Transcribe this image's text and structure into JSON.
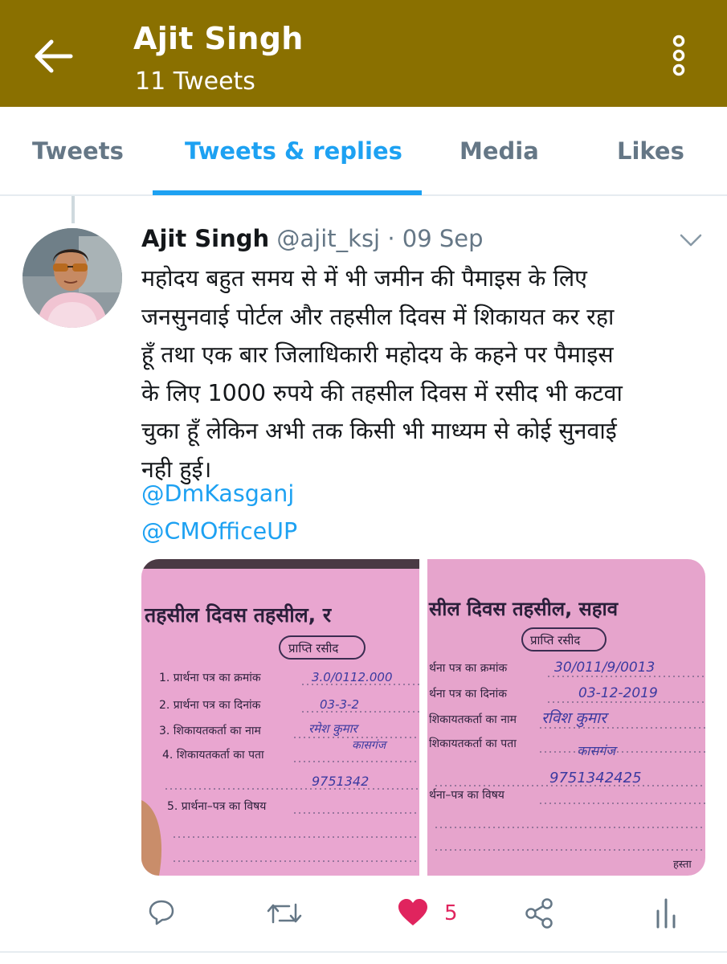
{
  "header": {
    "name": "Ajit Singh",
    "tweet_count": "11 Tweets",
    "background": "#8a7000"
  },
  "tabs": [
    {
      "label": "Tweets",
      "active": false
    },
    {
      "label": "Tweets & replies",
      "active": true
    },
    {
      "label": "Media",
      "active": false
    },
    {
      "label": "Likes",
      "active": false
    }
  ],
  "tweet": {
    "name": "Ajit Singh",
    "handle": "@ajit_ksj",
    "separator": "·",
    "date": "09 Sep",
    "text_lines": [
      "महोदय बहुत समय से में भी जमीन की पैमाइस के लिए",
      "जनसुनवाई पोर्टल और तहसील दिवस में शिकायत कर रहा",
      "हूँ तथा एक बार जिलाधिकारी महोदय के कहने पर पैमाइस",
      "के लिए 1000 रुपये की तहसील दिवस में रसीद भी कटवा",
      "चुका हूँ लेकिन अभी तक किसी भी माध्यम से कोई सुनवाई",
      "नही हुई।"
    ],
    "mentions": [
      "@DmKasganj",
      "@CMOfficeUP"
    ],
    "images": [
      {
        "heading": "तहसील दिवस तहसील, र",
        "stamp": "प्राप्ति रसीद",
        "rows": [
          {
            "label": "1. प्रार्थना पत्र का क्रमांक",
            "handwritten": "3.0/0112.000"
          },
          {
            "label": "2. प्रार्थना पत्र का दिनांक",
            "handwritten": "03-3-2"
          },
          {
            "label": "3. शिकायतकर्ता का नाम",
            "handwritten": "रमेश कुमार"
          },
          {
            "label": "4. शिकायतकर्ता का पता",
            "handwritten": "कासगंज"
          },
          {
            "label": "",
            "handwritten": "9751342"
          },
          {
            "label": "5. प्रार्थना–पत्र का विषय",
            "handwritten": ""
          }
        ]
      },
      {
        "heading": "सील दिवस तहसील, सहाव",
        "stamp": "प्राप्ति रसीद",
        "rows": [
          {
            "label": "र्थना पत्र का क्रमांक",
            "handwritten": "30/011/9/0013"
          },
          {
            "label": "र्थना पत्र का दिनांक",
            "handwritten": "03-12-2019"
          },
          {
            "label": "शिकायतकर्ता का नाम",
            "handwritten": "रविश कुमार"
          },
          {
            "label": "शिकायतकर्ता का पता",
            "handwritten": "कासगंज"
          },
          {
            "label": "",
            "handwritten": "9751342425"
          },
          {
            "label": "र्थना–पत्र का विषय",
            "handwritten": ""
          }
        ],
        "signature": "हस्ता"
      }
    ],
    "like_count": "5",
    "like_color": "#e0245e",
    "link_color": "#1da1f2"
  },
  "actions": [
    {
      "icon": "reply-icon"
    },
    {
      "icon": "retweet-icon"
    },
    {
      "icon": "heart-icon"
    },
    {
      "icon": "share-icon"
    },
    {
      "icon": "analytics-icon"
    }
  ]
}
